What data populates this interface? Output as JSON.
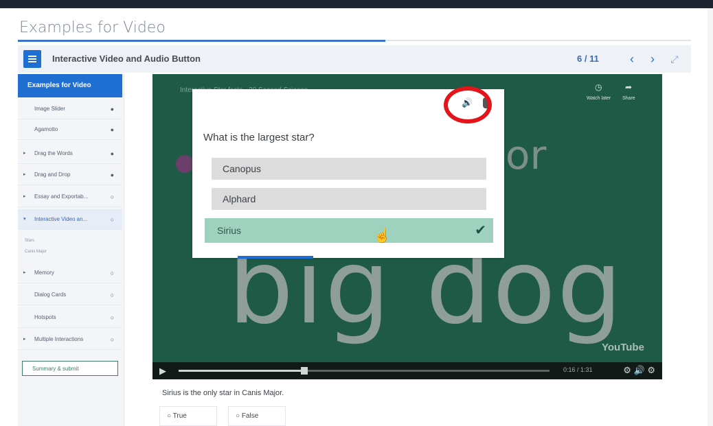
{
  "page": {
    "title": "Examples for Video"
  },
  "header": {
    "title": "Interactive Video and Audio Button",
    "count": "6 / 11",
    "prev_icon": "‹",
    "next_icon": "›",
    "fullscreen_icon": "⤢"
  },
  "sidebar": {
    "active": "Examples for Video",
    "items": [
      {
        "label": "Image Slider",
        "arrow": "",
        "status": "●"
      },
      {
        "label": "Agamotto",
        "arrow": "",
        "status": "●"
      },
      {
        "label": "Drag the Words",
        "arrow": "▸",
        "status": "●"
      },
      {
        "label": "Drag and Drop",
        "arrow": "▸",
        "status": "●"
      },
      {
        "label": "Essay and Exportab...",
        "arrow": "▸",
        "status": "○"
      },
      {
        "label": "Interactive Video an...",
        "arrow": "▾",
        "status": "○"
      },
      {
        "label": "Memory",
        "arrow": "▸",
        "status": "○"
      },
      {
        "label": "Dialog Cards",
        "arrow": "",
        "status": "○"
      },
      {
        "label": "Hotspots",
        "arrow": "",
        "status": "○"
      },
      {
        "label": "Multiple Interactions",
        "arrow": "▸",
        "status": "○"
      }
    ],
    "subitems": [
      "Stars",
      "Canis Major"
    ],
    "summary": "Summary & submit"
  },
  "video": {
    "title": "Interactive Star facts - 30 Second Science",
    "watch_later": "Watch later",
    "share": "Share",
    "bg_word_top": "or",
    "bg_word_main": "big dog",
    "brand": "YouTube",
    "time": "0:16 / 1:31"
  },
  "quiz": {
    "question": "What is the largest star?",
    "options": [
      "Canopus",
      "Alphard",
      "Sirius"
    ],
    "correct_index": 2
  },
  "below": {
    "caption": "Sirius is the only star in Canis Major.",
    "true_label": "True",
    "false_label": "False"
  },
  "colors": {
    "accent": "#1f6ed1",
    "video_bg": "#1f5a47",
    "correct": "#9fd2be",
    "highlight_ring": "#e3141a"
  }
}
